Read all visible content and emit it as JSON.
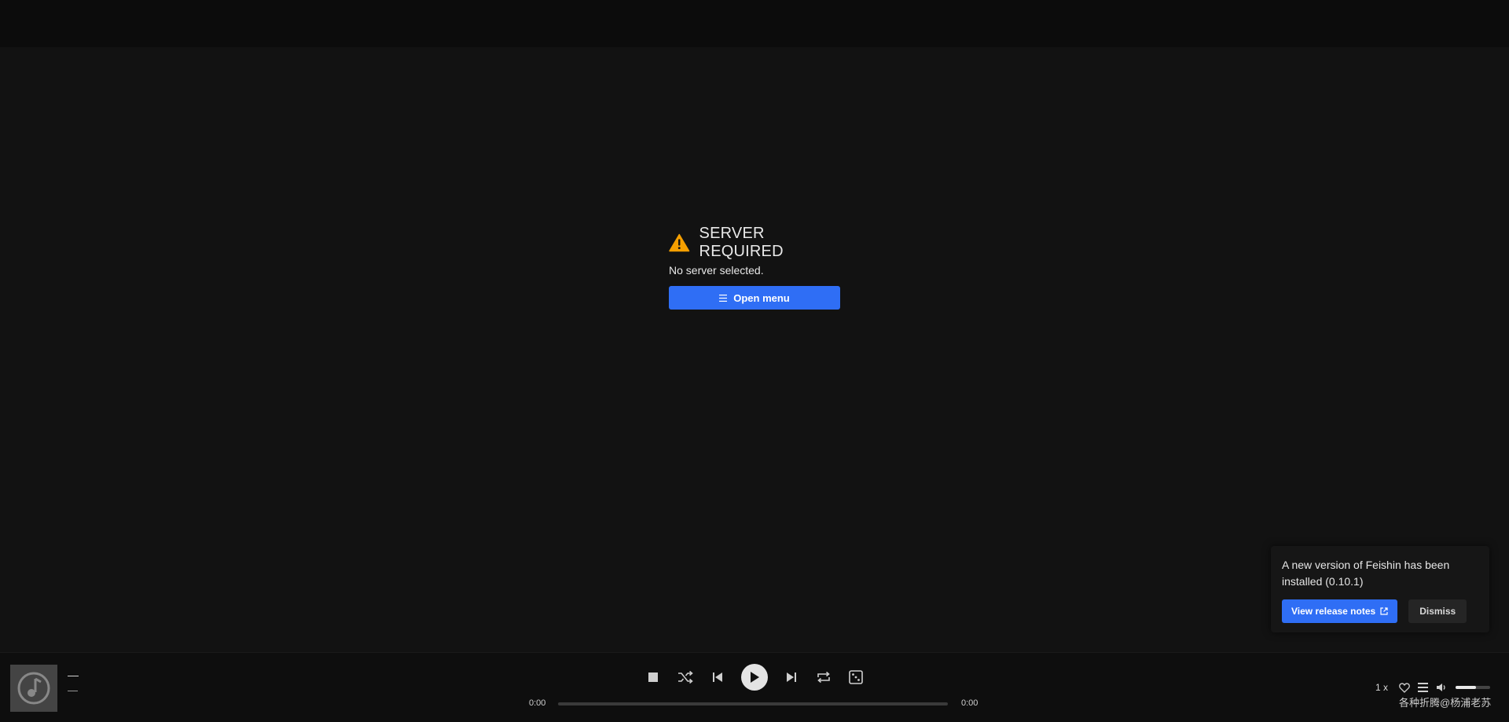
{
  "server_required": {
    "title": "SERVER REQUIRED",
    "message": "No server selected.",
    "open_menu_label": "Open menu"
  },
  "toast": {
    "message": "A new version of Feishin has been installed (0.10.1)",
    "view_release_notes_label": "View release notes",
    "dismiss_label": "Dismiss"
  },
  "player": {
    "track_title": "—",
    "track_artist": "—",
    "current_time": "0:00",
    "total_time": "0:00",
    "progress_fraction": 0,
    "playback_speed": "1 x",
    "volume_fraction": 0.6
  },
  "watermark": "各种折腾@杨浦老苏",
  "colors": {
    "accent": "#2f6ef5",
    "warning": "#f59f00",
    "background": "#121212"
  }
}
